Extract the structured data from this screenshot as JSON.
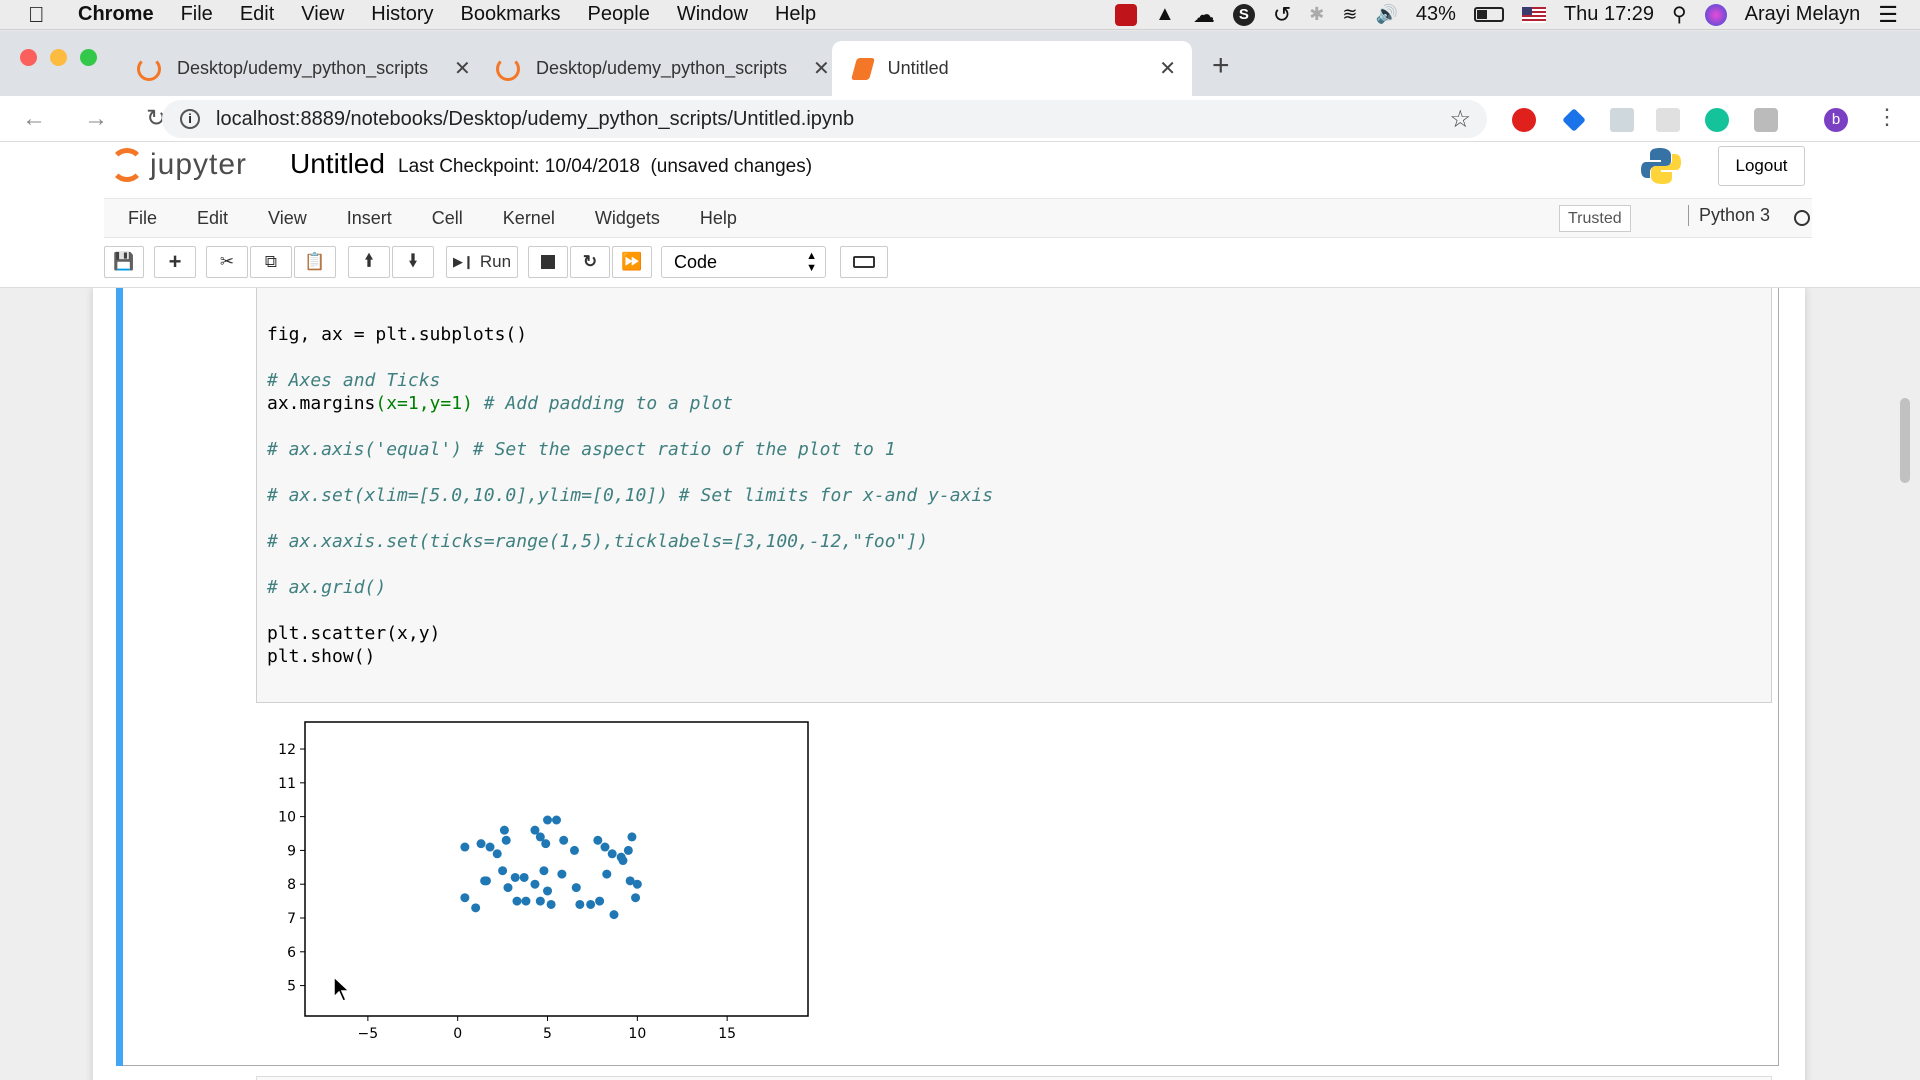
{
  "menubar": {
    "app": "Chrome",
    "items": [
      "File",
      "Edit",
      "View",
      "History",
      "Bookmarks",
      "People",
      "Window",
      "Help"
    ],
    "battery": "43%",
    "clock": "Thu 17:29",
    "user": "Arayi Melayn"
  },
  "tabs": [
    {
      "title": "Desktop/udemy_python_scripts"
    },
    {
      "title": "Desktop/udemy_python_scripts"
    },
    {
      "title": "Untitled"
    }
  ],
  "address": {
    "url": "localhost:8889/notebooks/Desktop/udemy_python_scripts/Untitled.ipynb"
  },
  "profile_initial": "b",
  "jupyter": {
    "logo_text": "jupyter",
    "notebook_title": "Untitled",
    "checkpoint": "Last Checkpoint: 10/04/2018",
    "unsaved": "(unsaved changes)",
    "logout": "Logout",
    "menu": [
      "File",
      "Edit",
      "View",
      "Insert",
      "Cell",
      "Kernel",
      "Widgets",
      "Help"
    ],
    "trusted": "Trusted",
    "kernel": "Python 3",
    "run_label": "Run",
    "cell_type": "Code"
  },
  "code": {
    "l1": "fig, ax = plt.subplots()",
    "l2": "# Axes and Ticks",
    "l3a": "ax.margins",
    "l3b": "(x=1,y=1)",
    "l3c": " # Add padding to a plot",
    "l4": "# ax.axis('equal') # Set the aspect ratio of the plot to 1",
    "l5": "# ax.set(xlim=[5.0,10.0],ylim=[0,10]) # Set limits for x-and y-axis",
    "l6": "# ax.xaxis.set(ticks=range(1,5),ticklabels=[3,100,-12,\"foo\"])",
    "l7": "# ax.grid()",
    "l8": "plt.scatter(x,y)",
    "l9": "plt.show()"
  },
  "chart_data": {
    "type": "scatter",
    "xlim": [
      -8.5,
      19.5
    ],
    "ylim": [
      4.1,
      12.8
    ],
    "xticks": [
      -5,
      0,
      5,
      10,
      15
    ],
    "yticks": [
      5,
      6,
      7,
      8,
      9,
      10,
      11,
      12
    ],
    "color": "#1f77b4",
    "points": [
      [
        0.4,
        9.1
      ],
      [
        1.3,
        9.2
      ],
      [
        1.8,
        9.1
      ],
      [
        2.2,
        8.9
      ],
      [
        2.6,
        9.6
      ],
      [
        2.7,
        9.3
      ],
      [
        3.7,
        8.2
      ],
      [
        4.3,
        9.6
      ],
      [
        4.6,
        9.4
      ],
      [
        4.9,
        9.2
      ],
      [
        5.0,
        9.9
      ],
      [
        5.5,
        9.9
      ],
      [
        5.9,
        9.3
      ],
      [
        6.5,
        9.0
      ],
      [
        7.8,
        9.3
      ],
      [
        8.2,
        9.1
      ],
      [
        8.6,
        8.9
      ],
      [
        9.1,
        8.8
      ],
      [
        9.5,
        9.0
      ],
      [
        9.7,
        9.4
      ],
      [
        0.4,
        7.6
      ],
      [
        1.0,
        7.3
      ],
      [
        1.5,
        8.1
      ],
      [
        2.8,
        7.9
      ],
      [
        3.2,
        8.2
      ],
      [
        3.3,
        7.5
      ],
      [
        3.8,
        7.5
      ],
      [
        4.6,
        7.5
      ],
      [
        4.8,
        8.4
      ],
      [
        5.0,
        7.8
      ],
      [
        5.2,
        7.4
      ],
      [
        5.8,
        8.3
      ],
      [
        6.6,
        7.9
      ],
      [
        7.4,
        7.4
      ],
      [
        7.9,
        7.5
      ],
      [
        8.3,
        8.3
      ],
      [
        8.7,
        7.1
      ],
      [
        9.6,
        8.1
      ],
      [
        9.9,
        7.6
      ],
      [
        10.0,
        8.0
      ],
      [
        4.3,
        8.0
      ],
      [
        2.5,
        8.4
      ],
      [
        9.2,
        8.7
      ],
      [
        1.6,
        8.1
      ],
      [
        6.8,
        7.4
      ]
    ]
  }
}
